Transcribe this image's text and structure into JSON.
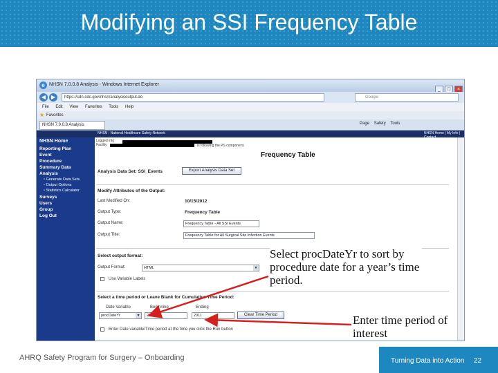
{
  "slide": {
    "title": "Modifying an SSI Frequency Table",
    "footer_left": "AHRQ Safety Program for Surgery – Onboarding",
    "footer_right": "Turning Data into Action",
    "page_number": "22"
  },
  "browser": {
    "window_title": "NHSN 7.0.0.8 Analysis - Windows Internet Explorer",
    "address": "https://sdn.cdc.gov/nhsn/analysisoutput.do",
    "search_placeholder": "Google",
    "menu": [
      "File",
      "Edit",
      "View",
      "Favorites",
      "Tools",
      "Help"
    ],
    "favorites_label": "Favorites",
    "tab_label": "NHSN 7.0.0.8 Analysis",
    "command_bar": [
      "Page",
      "Safety",
      "Tools"
    ]
  },
  "nhsn": {
    "header": "NHSN - National Healthcare Safety Network",
    "header_right": "NHSN Home | My Info | Contact",
    "sidebar": {
      "home": "NHSN Home",
      "items": [
        "Reporting Plan",
        "Event",
        "Procedure",
        "Summary Data",
        "Analysis"
      ],
      "subitems": [
        "Generate Data Sets",
        "Output Options",
        "Statistics Calculator"
      ],
      "items2": [
        "Surveys",
        "Users",
        "Group",
        "Log Out"
      ]
    },
    "logged_in_label": "Logged into",
    "facility_label": "Facility",
    "following_text": "is following the PS component.",
    "page_title": "Frequency Table",
    "dataset_label": "Analysis Data Set: SSI_Events",
    "export_button": "Export Analysis Data Set",
    "modify_heading": "Modify Attributes of the Output:",
    "last_modified_label": "Last Modified On:",
    "last_modified_value": "10/15/2012",
    "output_type_label": "Output Type:",
    "output_type_value": "Frequency Table",
    "output_name_label": "Output Name:",
    "output_name_value": "Frequency Table - All SSI Events",
    "output_title_label": "Output Title:",
    "output_title_value": "Frequency Table for All Surgical Site Infection Events",
    "select_format_heading": "Select output format:",
    "output_format_label": "Output Format:",
    "output_format_value": "HTML",
    "variable_labels_text": "Use Variable Labels",
    "time_period_heading": "Select a time period or Leave Blank for Cumulative Time Period:",
    "date_variable_label": "Date Variable",
    "beginning_label": "Beginning",
    "ending_label": "Ending",
    "date_variable_value": "procDateYr",
    "beginning_value": "2011",
    "ending_value": "2011",
    "clear_button": "Clear Time Period",
    "enter_date_text": "Enter Date variable/Time period at the time you click the Run button"
  },
  "callouts": {
    "c1": "Select procDateYr to sort by procedure date for a year’s time period.",
    "c2": "Enter time period of interest"
  }
}
